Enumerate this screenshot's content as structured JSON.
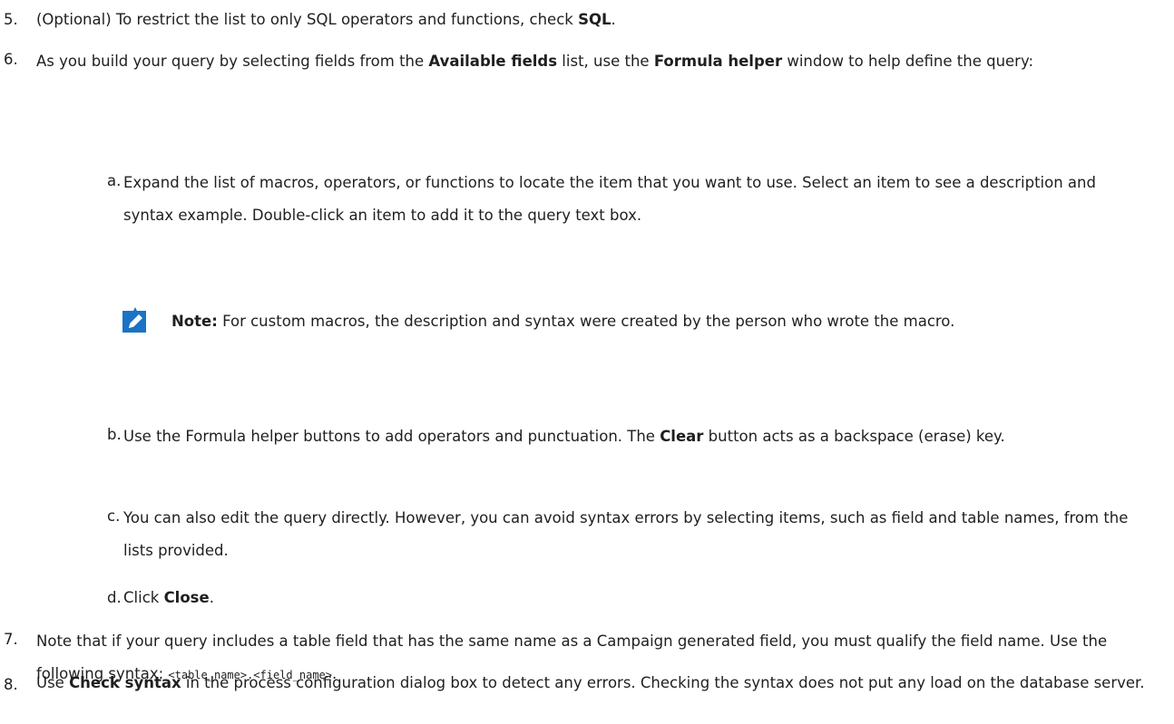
{
  "steps": [
    {
      "num": "5.",
      "before": "(Optional) To restrict the list to only SQL operators and functions, check ",
      "bold": "SQL",
      "after": "."
    },
    {
      "num": "6.",
      "p1": "As you build your query by selecting fields from the ",
      "b1": "Available fields",
      "p2": " list, use the ",
      "b2": "Formula helper",
      "p3": " window to help define the query:"
    },
    {
      "num": "7.",
      "text": "Note that if your query includes a table field that has the same name as a Campaign generated field, you must qualify the field name. Use the following syntax: ",
      "code": "<table_name>.<field_name>",
      "after": "."
    },
    {
      "num": "8.",
      "before": "Use ",
      "bold": "Check syntax",
      "after": " in the process configuration dialog box to detect any errors. Checking the syntax does not put any load on the database server."
    }
  ],
  "substeps": [
    {
      "letter": "a.",
      "text": "Expand the list of macros, operators, or functions to locate the item that you want to use. Select an item to see a description and syntax example. Double-click an item to add it to the query text box."
    },
    {
      "letter": "b.",
      "before": "Use the Formula helper buttons to add operators and punctuation. The ",
      "bold": "Clear",
      "after": " button acts as a backspace (erase) key."
    },
    {
      "letter": "c.",
      "text": "You can also edit the query directly. However, you can avoid syntax errors by selecting items, such as field and table names, from the lists provided."
    },
    {
      "letter": "d.",
      "before": "Click ",
      "bold": "Close",
      "after": "."
    }
  ],
  "note": {
    "label": "Note:",
    "text": " For custom macros, the description and syntax were created by the person who wrote the macro.",
    "icon": "pencil-note-icon",
    "icon_color": "#1a73c6"
  }
}
